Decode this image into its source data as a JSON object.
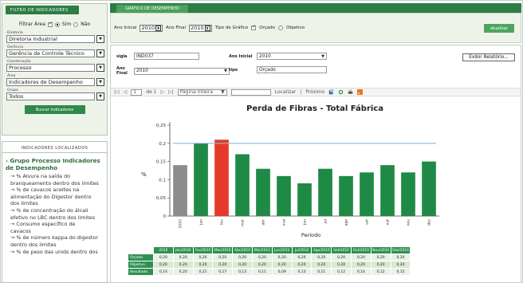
{
  "left": {
    "filters_header": "FILTRO DE INDICADORES",
    "filter_area": {
      "label": "Filtrar Área",
      "checked": true,
      "opt_yes": "Sim",
      "opt_no": "Não",
      "selected": "Sim"
    },
    "fields": [
      {
        "label": "Diretoria",
        "value": "Diretoria Industrial"
      },
      {
        "label": "Gerência",
        "value": "Gerência de Controle Técnico"
      },
      {
        "label": "Coordenação",
        "value": "Processo"
      },
      {
        "label": "Área",
        "value": "Indicadores de Desempenho"
      },
      {
        "label": "Grupo",
        "value": "Todos"
      }
    ],
    "search_button": "Buscar Indicadores",
    "found_header": "INDICADORES LOCALIZADOS",
    "group_title": "› Grupo Processo Indicadores de Desempenho",
    "items": [
      "→ % Alvura na saída do",
      "branqueamento dentro dos limites",
      "→ % de cavacos aceites na",
      "alimentação do Digestor dentro",
      "dos limites",
      "→ % de concentração do álcali",
      "efetivo no LBC dentro dos limites",
      "→ Consumo específico de",
      "cavacos",
      "→ % de número kappa do digestor",
      "dentro dos limites",
      "→ % de peso das unids dentro dos"
    ]
  },
  "right": {
    "tab_label": "GRÁFICO DE DESEMPENHO",
    "params": {
      "ano_inicial_label": "Ano Inicial",
      "ano_inicial": "2010",
      "ano_final_label": "Ano Final",
      "ano_final": "2010",
      "tipo_label": "Tipo de Gráfico",
      "opt_orcado": "Orçado",
      "opt_objetivo": "Objetivo"
    },
    "update_button": "atualizar",
    "report": {
      "sigla_label": "sigla",
      "sigla": "IND037",
      "ano_inicial_label": "Ano Inicial",
      "ano_inicial": "2010",
      "ano_final_label": "Ano Final",
      "ano_final": "2010",
      "tipo_label": "tipo",
      "tipo": "Orçado",
      "exibir_button": "Exibir Relatório..."
    },
    "toolbar": {
      "first": "|◁",
      "prev": "◁",
      "page": "1",
      "of": "de 1",
      "next": "▷",
      "last": "▷|",
      "zoom": "Página Inteira",
      "find_label": "Localizar",
      "next_label": "Próximo"
    },
    "accent_color": "#2d7d45"
  },
  "chart_data": {
    "type": "bar",
    "title": "Perda de Fibras - Total Fábrica",
    "xlabel": "Período",
    "ylabel": "%",
    "ylim": [
      0,
      0.25
    ],
    "yticks": [
      "0,25",
      "0,2",
      "0,15",
      "0,1",
      "0,05",
      "0"
    ],
    "categories": [
      "2010",
      "jan",
      "fev",
      "mar",
      "abr",
      "mai",
      "jun",
      "jul",
      "ago",
      "set",
      "out",
      "nov",
      "dez"
    ],
    "values": [
      0.14,
      0.2,
      0.21,
      0.17,
      0.13,
      0.11,
      0.09,
      0.13,
      0.11,
      0.12,
      0.14,
      0.12,
      0.15
    ],
    "bar_colors": [
      "#8c8c8c",
      "#1f8a45",
      "#e53a2a",
      "#1f8a45",
      "#1f8a45",
      "#1f8a45",
      "#1f8a45",
      "#1f8a45",
      "#1f8a45",
      "#1f8a45",
      "#1f8a45",
      "#1f8a45",
      "#1f8a45"
    ],
    "target_line": 0.2,
    "grid": false
  },
  "table": {
    "headers": [
      "2010",
      "Jan/2010",
      "Fev/2010",
      "Mar/2010",
      "Abr/2010",
      "Mai/2010",
      "Jun/2010",
      "Jul/2010",
      "Ago/2010",
      "Set/2010",
      "Out/2010",
      "Nov/2010",
      "Dez/2010"
    ],
    "rows": [
      {
        "label": "Orçado",
        "values": [
          "0,20",
          "0,20",
          "0,20",
          "0,20",
          "0,20",
          "0,20",
          "0,20",
          "0,20",
          "0,20",
          "0,20",
          "0,20",
          "0,20",
          "0,20"
        ]
      },
      {
        "label": "Objetivo",
        "values": [
          "0,20",
          "0,20",
          "0,20",
          "0,20",
          "0,20",
          "0,20",
          "0,20",
          "0,20",
          "0,20",
          "0,20",
          "0,20",
          "0,20",
          "0,20"
        ]
      },
      {
        "label": "Resultado",
        "values": [
          "0,14",
          "0,20",
          "0,21",
          "0,17",
          "0,13",
          "0,11",
          "0,09",
          "0,13",
          "0,11",
          "0,12",
          "0,14",
          "0,12",
          "0,15"
        ]
      }
    ]
  }
}
